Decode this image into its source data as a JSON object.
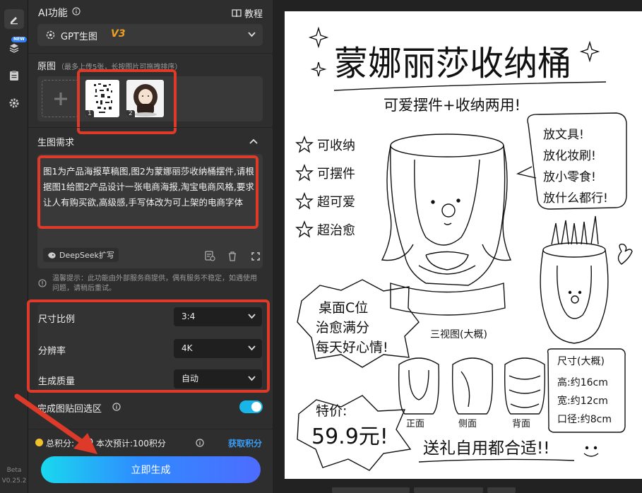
{
  "rail": {
    "version_line1": "Beta",
    "version_line2": "V0.25.2",
    "new_badge": "NEW"
  },
  "header": {
    "title": "AI功能",
    "tutorial_label": "教程"
  },
  "model": {
    "name": "GPT生图",
    "version": "V3"
  },
  "source_images": {
    "label": "原图",
    "note": "（最多上传5张，长按图片可拖拽排序）",
    "thumbs": [
      {
        "index": "1"
      },
      {
        "index": "2"
      }
    ]
  },
  "prompt": {
    "label": "生图需求",
    "text": "图1为产品海报草稿图,图2为蒙娜丽莎收纳桶摆件,请根据图1给图2产品设计一张电商海报,淘宝电商风格,要求让人有购买欲,高级感,手写体改为可上架的电商字体",
    "expand_label": "DeepSeek扩写"
  },
  "notice": "温馨提示：此功能由外部服务商提供，偶有服务不稳定，如遇使用问题，请稍后重试。",
  "settings": [
    {
      "label": "尺寸比例",
      "value": "3:4"
    },
    {
      "label": "分辨率",
      "value": "4K"
    },
    {
      "label": "生成质量",
      "value": "自动"
    }
  ],
  "paste_back": {
    "label": "完成图贴回选区",
    "enabled": true
  },
  "credits": {
    "total": "总积分:",
    "total_value": "710",
    "estimate": "本次预计:100积分",
    "get_label": "获取积分"
  },
  "generate_label": "立即生成",
  "poster": {
    "title": "蒙娜丽莎收纳桶",
    "subtitle": "可爱摆件+收纳两用!",
    "features": [
      "可收纳",
      "可摆件",
      "超可爱",
      "超治愈"
    ],
    "bubble_right": [
      "放文具!",
      "放化妆刷!",
      "放小零食!",
      "放什么都行!"
    ],
    "bubble_left": [
      "桌面C位",
      "治愈满分",
      "每天好心情!"
    ],
    "views_title": "三视图(大概)",
    "views": [
      "正面",
      "侧面",
      "背面"
    ],
    "size_title": "尺寸(大概)",
    "sizes": [
      "高:约16cm",
      "宽:约12cm",
      "口径:约8cm"
    ],
    "price_label": "特价:",
    "price": "59.9元!",
    "footer": "送礼自用都合适!!"
  },
  "colors": {
    "accent": "#19d8ee",
    "brand_blue": "#2f8bff",
    "highlight": "#dd3a2a",
    "model_version": "#f0a020",
    "link": "#3a9ef7"
  }
}
